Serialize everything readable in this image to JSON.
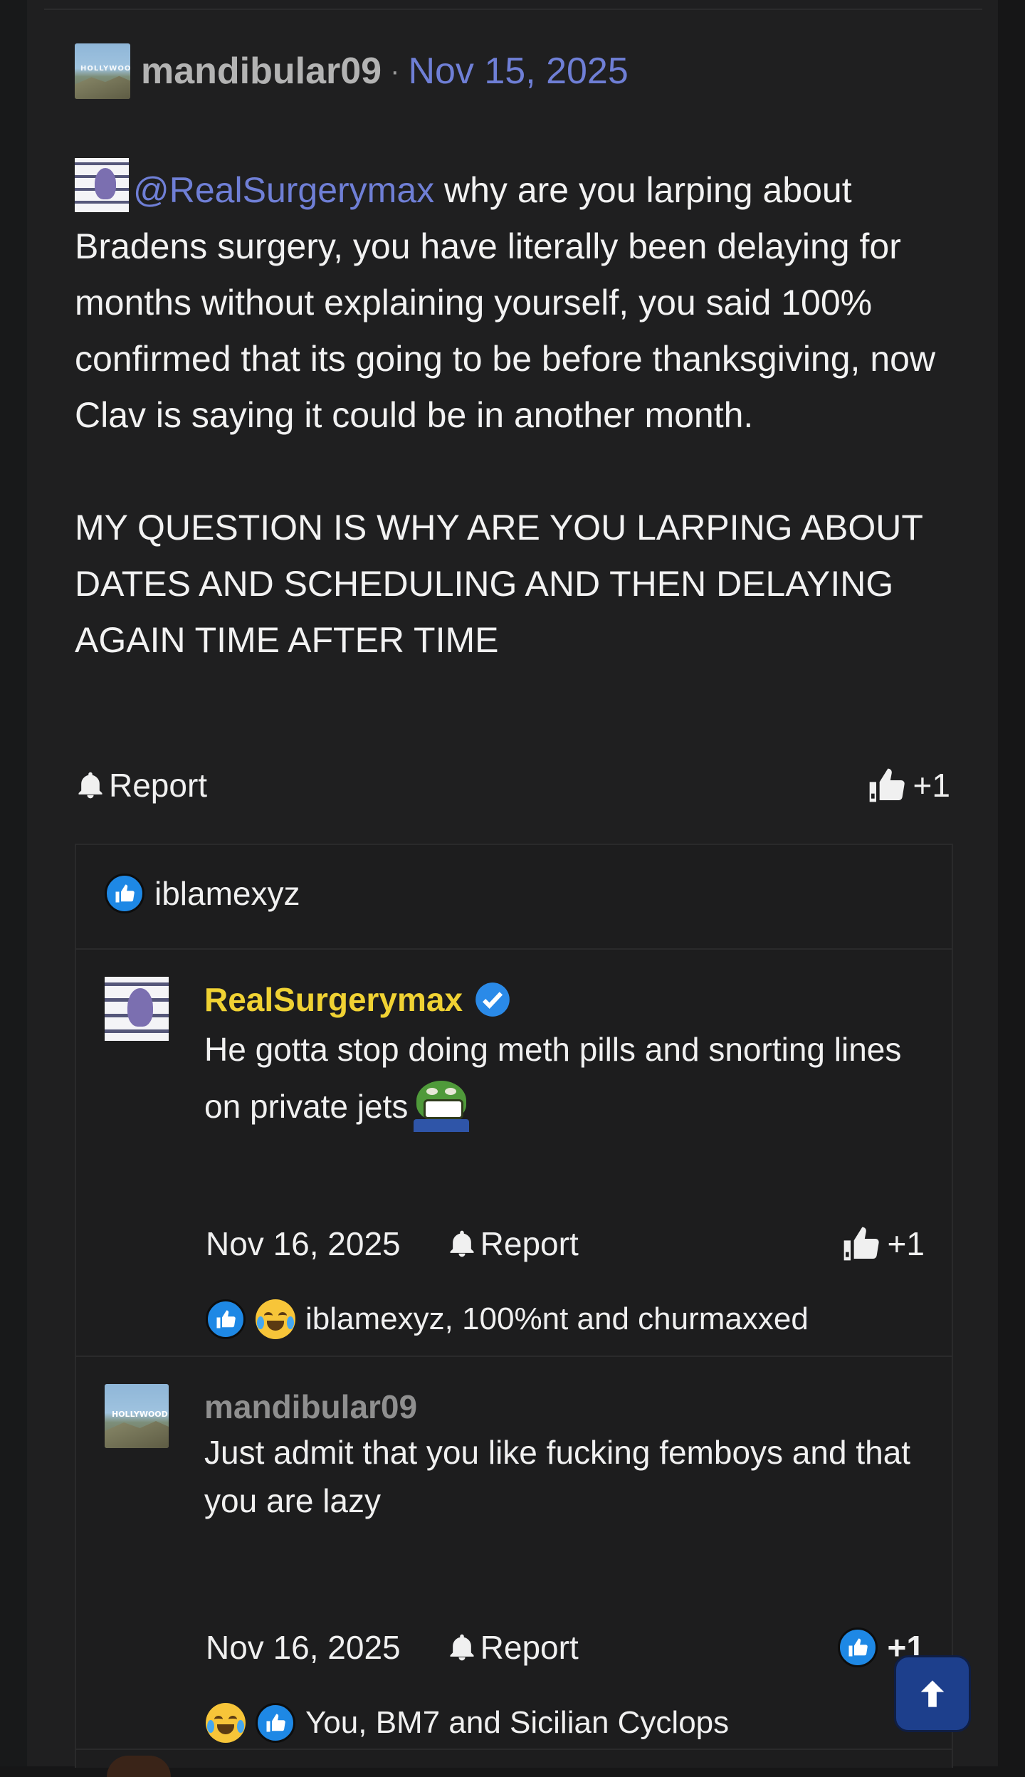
{
  "post": {
    "author": "mandibular09",
    "separator": "·",
    "date": "Nov 15, 2025",
    "mention": "@RealSurgerymax",
    "body": " why are you larping about Bradens surgery, you have literally been delaying for months without explaining yourself, you said 100% confirmed that its going to be before thanksgiving, now Clav is saying it could be in another month.",
    "caps": "MY QUESTION IS WHY ARE YOU LARPING ABOUT DATES AND SCHEDULING AND THEN DELAYING AGAIN TIME AFTER TIME",
    "report_label": "Report",
    "reaction_count": "+1",
    "reactors": "iblamexyz"
  },
  "comments": [
    {
      "author": "RealSurgerymax",
      "text": "He gotta stop doing meth pills and snorting lines on private jets",
      "date": "Nov 16, 2025",
      "report_label": "Report",
      "reaction_count": "+1",
      "reactors": "iblamexyz, 100%nt and churmaxxed"
    },
    {
      "author": "mandibular09",
      "text": "Just admit that you like fucking femboys and that you are lazy",
      "date": "Nov 16, 2025",
      "report_label": "Report",
      "reaction_count": "+1",
      "reactors": "You, BM7 and Sicilian Cyclops"
    }
  ],
  "icons": {
    "report": "bell-icon",
    "react": "thumbs-up-icon",
    "like": "like-reaction-icon",
    "laugh": "laugh-reaction-icon",
    "verified": "verified-badge-icon",
    "scroll_top": "arrow-up-icon"
  },
  "colors": {
    "background": "#1f1f20",
    "link": "#6f7fd6",
    "staff_name": "#f0d233",
    "like_blue": "#1e88e5",
    "scroll_button": "#1d3f8c"
  }
}
